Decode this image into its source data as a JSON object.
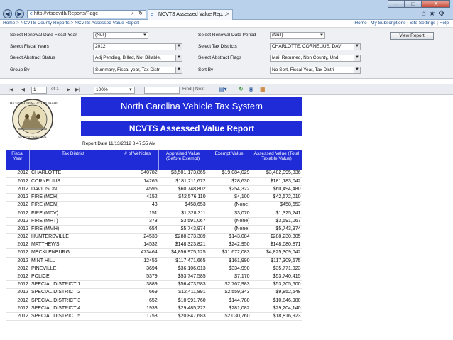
{
  "browser": {
    "url": "http://vtsdevdb/Reports/Page",
    "tab_title": "NCVTS Assessed Value Rep...",
    "window_buttons": [
      "–",
      "□",
      "X"
    ],
    "toolbar_icons": [
      "home-icon",
      "star-icon",
      "gear-icon"
    ]
  },
  "breadcrumb": {
    "path": "Home > NCVTS County Reports > NCVTS Assessed Value Report",
    "links": "Home | My Subscriptions | Site Settings | Help"
  },
  "params": {
    "renewal_fiscal_year": {
      "label": "Select Renewal Date Fiscal Year",
      "value": "(Null)"
    },
    "renewal_period": {
      "label": "Select Renewal Date Period",
      "value": "(Null)"
    },
    "fiscal_years": {
      "label": "Select Fiscal Years",
      "value": "2012"
    },
    "tax_districts": {
      "label": "Select Tax Districts",
      "value": "CHARLOTTE, CORNELIUS, DAVI"
    },
    "abstract_status": {
      "label": "Select Abstract Status",
      "value": "Adj Pending, Billed, Not Billable,"
    },
    "abstract_flags": {
      "label": "Select Abstract Flags",
      "value": "Mail Returned, Non County, Und"
    },
    "group_by": {
      "label": "Group By",
      "value": "Summary, Fiscal year, Tax Distr"
    },
    "sort_by": {
      "label": "Sort By",
      "value": "No Sort, Fiscal Year, Tax Distri"
    },
    "view_report": "View Report"
  },
  "report_toolbar": {
    "page": "1",
    "of_pages": "of 1",
    "zoom": "100%",
    "find": "Find | Next"
  },
  "report": {
    "title": "North Carolina Vehicle Tax System",
    "subtitle": "NCVTS Assessed Value Report",
    "report_date": "Report Date 11/13/2012 8:47:55 AM",
    "columns": [
      "Fiscal Year",
      "Tax District",
      "# of Vehicles",
      "Appraised Value (Before Exempt)",
      "Exempt Value",
      "Assessed Value (Total Taxable Value)"
    ],
    "rows": [
      [
        "2012",
        "CHARLOTTE",
        "340782",
        "$3,501,173,865",
        "$19,084,029",
        "$3,482,095,836"
      ],
      [
        "2012",
        "CORNELIUS",
        "14265",
        "$181,211,672",
        "$28,630",
        "$181,183,042"
      ],
      [
        "2012",
        "DAVIDSON",
        "4595",
        "$60,748,802",
        "$254,322",
        "$60,494,480"
      ],
      [
        "2012",
        "FIRE (MCH)",
        "4152",
        "$42,576,110",
        "$4,100",
        "$42,572,010"
      ],
      [
        "2012",
        "FIRE (MCN)",
        "43",
        "$458,653",
        "(None)",
        "$458,653"
      ],
      [
        "2012",
        "FIRE (MDV)",
        "151",
        "$1,328,311",
        "$3,070",
        "$1,325,241"
      ],
      [
        "2012",
        "FIRE (MHT)",
        "373",
        "$3,591,067",
        "(None)",
        "$3,591,067"
      ],
      [
        "2012",
        "FIRE (MMH)",
        "654",
        "$5,743,974",
        "(None)",
        "$5,743,974"
      ],
      [
        "2012",
        "HUNTERSVILLE",
        "24530",
        "$288,373,389",
        "$143,084",
        "$288,230,305"
      ],
      [
        "2012",
        "MATTHEWS",
        "14532",
        "$148,323,821",
        "$242,950",
        "$148,080,871"
      ],
      [
        "2012",
        "MECKLENBURG",
        "473464",
        "$4,856,975,125",
        "$31,672,083",
        "$4,825,309,042"
      ],
      [
        "2012",
        "MINT HILL",
        "12456",
        "$117,471,665",
        "$161,990",
        "$117,309,675"
      ],
      [
        "2012",
        "PINEVILLE",
        "3694",
        "$36,106,013",
        "$334,990",
        "$35,771,023"
      ],
      [
        "2012",
        "POLICE",
        "5379",
        "$53,747,585",
        "$7,170",
        "$53,740,415"
      ],
      [
        "2012",
        "SPECIAL DISTRICT 1",
        "3889",
        "$56,473,583",
        "$2,767,983",
        "$53,705,600"
      ],
      [
        "2012",
        "SPECIAL DISTRICT 2",
        "669",
        "$12,411,891",
        "$2,559,343",
        "$9,852,548"
      ],
      [
        "2012",
        "SPECIAL DISTRICT 3",
        "652",
        "$10,991,760",
        "$144,780",
        "$10,846,980"
      ],
      [
        "2012",
        "SPECIAL DISTRICT 4",
        "1933",
        "$29,485,222",
        "$281,082",
        "$29,204,140"
      ],
      [
        "2012",
        "SPECIAL DISTRICT 5",
        "1753",
        "$20,847,683",
        "$2,030,760",
        "$18,816,923"
      ]
    ]
  },
  "colors": {
    "report_blue": "#1f2bd6",
    "chrome": "#b9d1ea"
  }
}
